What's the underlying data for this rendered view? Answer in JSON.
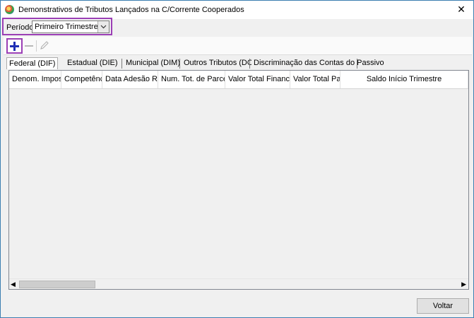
{
  "window": {
    "title": "Demonstrativos de Tributos Lançados na C/Corrente Cooperados",
    "close_glyph": "✕"
  },
  "periodo": {
    "label": "Período:",
    "value": "Primeiro Trimestre"
  },
  "toolbar": {
    "icons": [
      "add-icon",
      "remove-icon",
      "edit-icon"
    ]
  },
  "tabs": [
    {
      "label": "Federal (DIF)",
      "active": true
    },
    {
      "label": "Estadual (DIE)",
      "active": false
    },
    {
      "label": "Municipal (DIM)",
      "active": false
    },
    {
      "label": "Outros Tributos (DOT)",
      "active": false
    },
    {
      "label": "Discriminação das Contas do Passivo",
      "active": false
    }
  ],
  "grid": {
    "columns": [
      "Denom. Imposto",
      "Competência",
      "Data Adesão Refis",
      "Num. Tot. de Parcelas",
      "Valor Total Financiado",
      "Valor Total Pago",
      "Saldo Início Trimestre"
    ],
    "rows": []
  },
  "footer": {
    "voltar_label": "Voltar"
  },
  "colors": {
    "highlight": "#9b3fb5",
    "add_icon": "#1f2fb4",
    "window_border": "#3c7fb1"
  }
}
